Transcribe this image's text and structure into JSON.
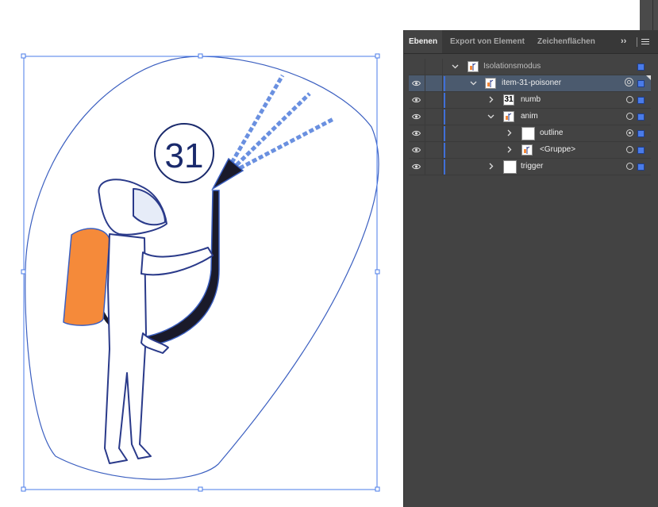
{
  "panel": {
    "tabs": [
      {
        "label": "Ebenen",
        "active": true
      },
      {
        "label": "Export von Element",
        "active": false
      },
      {
        "label": "Zeichenflächen",
        "active": false
      }
    ],
    "more_glyph": "››",
    "menu_icon": "hamburger-menu-icon"
  },
  "layers": [
    {
      "label": "Isolationsmodus",
      "visible": false,
      "expanded": true,
      "thumb": "figure",
      "target": "none",
      "selected_square": true
    },
    {
      "label": "item-31-poisoner",
      "visible": true,
      "expanded": true,
      "thumb": "figure",
      "target": "double",
      "selected_square": true,
      "row_selected": true
    },
    {
      "label": "numb",
      "visible": true,
      "expanded": false,
      "thumb": "31",
      "target": "empty",
      "selected_square": true
    },
    {
      "label": "anim",
      "visible": true,
      "expanded": true,
      "thumb": "figure",
      "target": "empty",
      "selected_square": true
    },
    {
      "label": "outline",
      "visible": true,
      "expanded": false,
      "thumb": "blank",
      "target": "filled",
      "selected_square": true
    },
    {
      "label": "<Gruppe>",
      "visible": true,
      "expanded": false,
      "thumb": "figure",
      "target": "empty",
      "selected_square": true
    },
    {
      "label": "trigger",
      "visible": true,
      "expanded": false,
      "thumb": "blank",
      "target": "empty",
      "selected_square": true
    }
  ],
  "artwork": {
    "number_label": "31",
    "tank_color": "#f58a3a",
    "outline_color": "#3b5fc0"
  },
  "colors": {
    "selection_blue": "#4a7be8",
    "panel_bg": "#434343",
    "row_selected": "#4b5a6e"
  }
}
